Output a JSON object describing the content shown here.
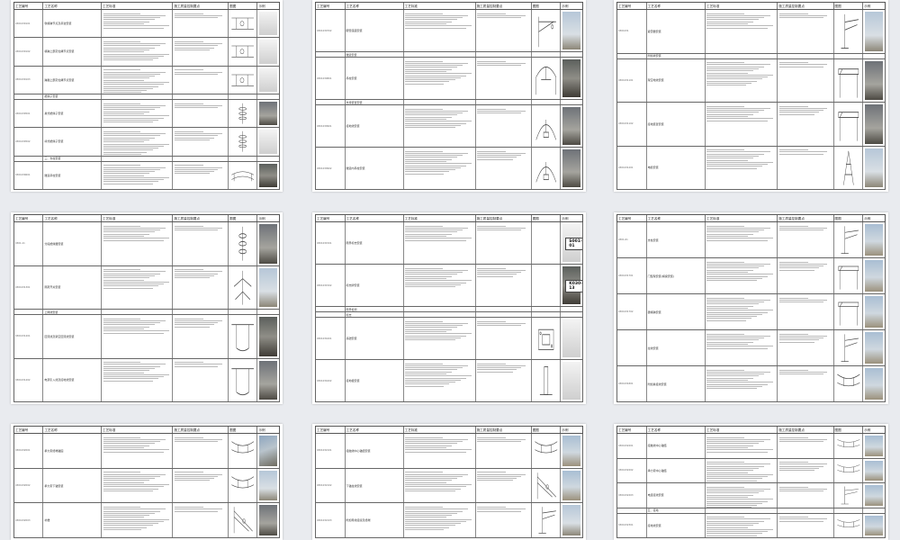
{
  "header": {
    "col_code": "工艺编号",
    "col_name": "工艺名称",
    "col_standard": "工艺标准",
    "col_control": "施工质量控制要点",
    "col_figure": "图图",
    "col_example": "示例"
  },
  "pages": [
    {
      "rows": [
        {
          "code": "0301030101",
          "name": "软横跨节点及吊弦安装"
        },
        {
          "code": "0301030102",
          "name": "横跨上部定位绳节点安装"
        },
        {
          "code": "0301030103",
          "name": "跨越上部定位绳节点安装"
        },
        {
          "code": "",
          "name": "绝缘子安装"
        },
        {
          "code": "0301030501",
          "name": "悬式绝缘子安装"
        },
        {
          "code": "0301030502",
          "name": "棒式绝缘子安装"
        },
        {
          "code": "",
          "name": "三、支柱安装"
        },
        {
          "code": "0301030601",
          "name": "隧道吊柱安装"
        }
      ]
    },
    {
      "rows": [
        {
          "code": "0301030702",
          "name": "腕臂底座安装"
        },
        {
          "code": "",
          "name": "隧道安装"
        },
        {
          "code": "0301030801",
          "name": "吊柱安装"
        },
        {
          "code": "",
          "name": "支持装置安装"
        },
        {
          "code": "0301030901",
          "name": "接地线安装"
        },
        {
          "code": "0301030902",
          "name": "隧道内吊柱安装"
        }
      ]
    },
    {
      "rows": [
        {
          "code": "0301031",
          "name": "避雷器安装"
        },
        {
          "code": "",
          "name": "附加线安装"
        },
        {
          "code": "0301031101",
          "name": "架空地线安装"
        },
        {
          "code": "0301031102",
          "name": "接地装置安装"
        },
        {
          "code": "0301031201",
          "name": "电缆安装"
        }
      ]
    },
    {
      "rows": [
        {
          "code": "0301-11",
          "name": "分段绝缘器安装"
        },
        {
          "code": "0301031301",
          "name": "隔离开关安装"
        },
        {
          "code": "",
          "name": "上网线安装"
        },
        {
          "code": "0301031401",
          "name": "回流线及架空回流线安装"
        },
        {
          "code": "0301031402",
          "name": "电源引入线及接地线安装"
        }
      ]
    },
    {
      "rows": [
        {
          "code": "0301031501",
          "name": "限界标志安装"
        },
        {
          "code": "0301031502",
          "name": "标志牌安装"
        },
        {
          "code": "",
          "name": "限界检测"
        },
        {
          "code": "",
          "name": "标志"
        },
        {
          "code": "0301031601",
          "name": "基础安装"
        },
        {
          "code": "0301031602",
          "name": "接地极安装"
        }
      ]
    },
    {
      "rows": [
        {
          "code": "0301-01",
          "name": "支柱安装"
        },
        {
          "code": "0301031701",
          "name": "门型架安装(横梁安装)"
        },
        {
          "code": "0301031702",
          "name": "硬横跨安装"
        },
        {
          "code": "",
          "name": "拉线安装"
        },
        {
          "code": "0301031801",
          "name": "附加悬挂线安装"
        }
      ]
    },
    {
      "rows": [
        {
          "code": "0301032001",
          "name": "承力索终端锚固"
        },
        {
          "code": "0301032002",
          "name": "承力索下锚安装"
        },
        {
          "code": "0301032003",
          "name": "补偿"
        }
      ]
    },
    {
      "rows": [
        {
          "code": "0301032101",
          "name": "接触线中心锚结安装"
        },
        {
          "code": "0301032102",
          "name": "下锚拉线安装"
        },
        {
          "code": "0301032103",
          "name": "附加导线接续及终端"
        }
      ]
    },
    {
      "rows": [
        {
          "code": "0301032201",
          "name": "接触线中心锚结"
        },
        {
          "code": "0301032202",
          "name": "承力索中心锚结"
        },
        {
          "code": "0301032203",
          "name": "电连接线安装"
        },
        {
          "code": "",
          "name": "五、接地"
        },
        {
          "code": "0301032301",
          "name": "接地线安装"
        }
      ]
    }
  ],
  "signs": {
    "sign_a": "S001-01",
    "sign_b": "K030-13"
  }
}
